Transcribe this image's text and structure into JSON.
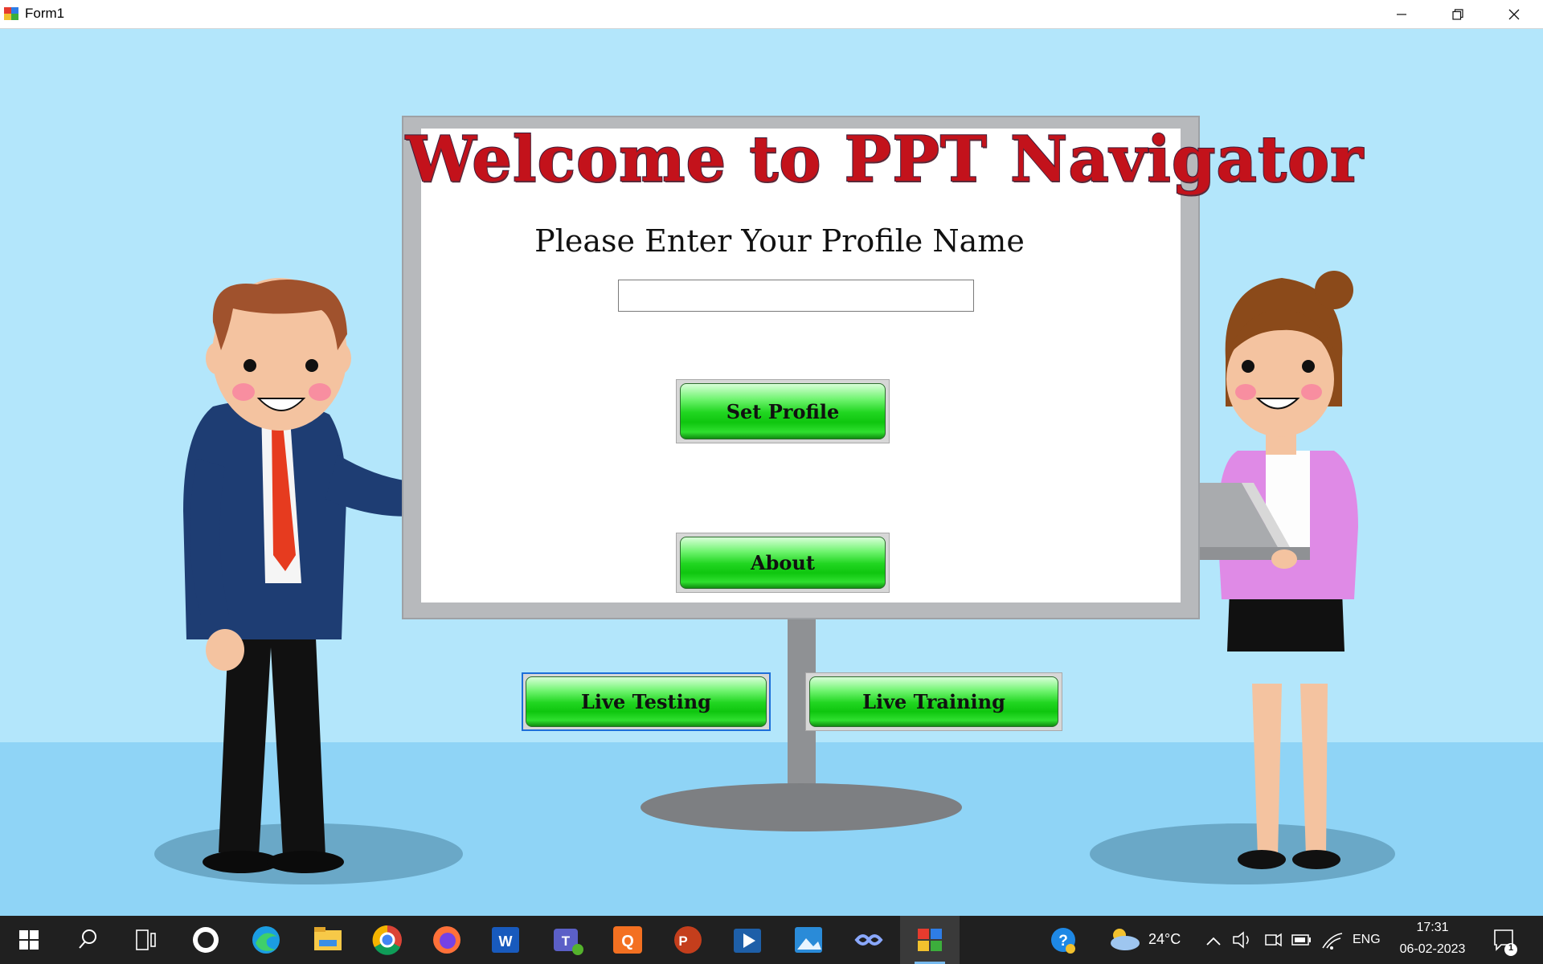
{
  "window": {
    "title": "Form1",
    "icons": {
      "app": "form-app-icon",
      "minimize": "minimize-icon",
      "restore": "restore-icon",
      "close": "close-icon"
    }
  },
  "board": {
    "headline": "Welcome to PPT Navigator",
    "prompt": "Please Enter Your Profile Name",
    "profile_input_value": "",
    "profile_input_placeholder": ""
  },
  "buttons": {
    "set_profile": "Set Profile",
    "about": "About",
    "live_testing": "Live Testing",
    "live_training": "Live Training"
  },
  "taskbar": {
    "weather_temp": "24°C",
    "language": "ENG",
    "time": "17:31",
    "date": "06-02-2023",
    "notification_count": "1",
    "apps": [
      "windows-start-icon",
      "search-icon",
      "task-view-icon",
      "snipping-tool-icon",
      "edge-icon",
      "file-explorer-icon",
      "chrome-icon",
      "firefox-icon",
      "word-icon",
      "teams-icon",
      "qr-app-icon",
      "powerpoint-icon",
      "video-player-icon",
      "photos-icon",
      "infinity-app-icon",
      "form1-app-icon"
    ]
  },
  "colors": {
    "sky": "#b3e6fb",
    "floor": "#8fd4f6",
    "headline": "#c3121b",
    "button_green": "#21d621",
    "focus_border": "#1e6fd9",
    "taskbar": "#202020"
  }
}
